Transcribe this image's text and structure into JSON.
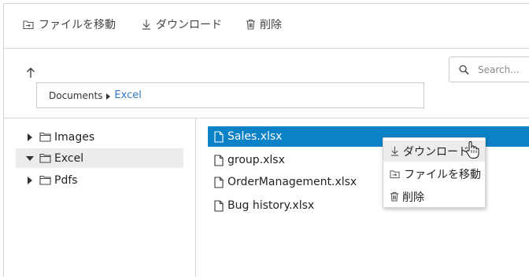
{
  "toolbar": {
    "move_label": "ファイルを移動",
    "download_label": "ダウンロード",
    "delete_label": "削除",
    "move_icon": "folder-move-icon",
    "download_icon": "download-icon",
    "delete_icon": "trash-icon"
  },
  "navigation": {
    "up_icon": "arrow-up-icon"
  },
  "breadcrumb": {
    "items": [
      "Documents",
      "Excel"
    ]
  },
  "search": {
    "placeholder": "Search...",
    "icon": "search-icon"
  },
  "tree": {
    "items": [
      {
        "label": "Images",
        "expanded": false,
        "selected": false
      },
      {
        "label": "Excel",
        "expanded": true,
        "selected": true
      },
      {
        "label": "Pdfs",
        "expanded": false,
        "selected": false
      }
    ]
  },
  "files": {
    "items": [
      {
        "name": "Sales.xlsx",
        "selected": true
      },
      {
        "name": "group.xlsx",
        "selected": false
      },
      {
        "name": "OrderManagement.xlsx",
        "selected": false
      },
      {
        "name": "Bug history.xlsx",
        "selected": false
      }
    ]
  },
  "context_menu": {
    "items": [
      {
        "label": "ダウンロード",
        "icon": "download-icon",
        "hovered": true
      },
      {
        "label": "ファイルを移動",
        "icon": "folder-move-icon",
        "hovered": false
      },
      {
        "label": "削除",
        "icon": "trash-icon",
        "hovered": false
      }
    ]
  },
  "colors": {
    "accent": "#0b82c7",
    "link": "#2f79c3",
    "selection_gray": "#ececec"
  }
}
